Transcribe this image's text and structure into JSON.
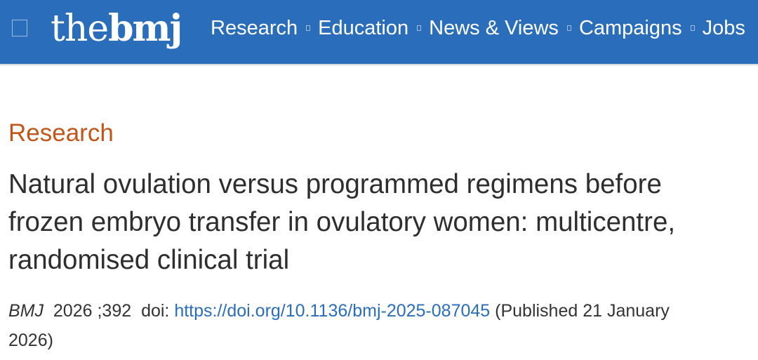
{
  "header": {
    "logo": {
      "light": "the",
      "bold": "bmj"
    },
    "nav": [
      {
        "label": "Research"
      },
      {
        "label": "Education"
      },
      {
        "label": "News & Views"
      },
      {
        "label": "Campaigns"
      },
      {
        "label": "Jobs"
      }
    ]
  },
  "article": {
    "section": "Research",
    "title_lines": [
      "Natural ovulation versus programmed regimens before",
      "frozen embryo transfer in ovulatory women: multicentre,",
      "randomised clinical trial"
    ],
    "citation": {
      "journal": "BMJ",
      "year": "2026",
      "volume": ";392",
      "doi_label": "doi:",
      "doi_url": "https://doi.org/10.1136/bmj-2025-087045",
      "published_part1": "(Published 21 January",
      "published_part2": "2026)"
    }
  },
  "colors": {
    "header_bg": "#2a6ebb",
    "section_label": "#c05718",
    "link": "#2a6ebb",
    "title_text": "#2e2e2e"
  },
  "icons": {
    "menu": "menu-icon",
    "nav_separator": "square-separator-icon"
  }
}
